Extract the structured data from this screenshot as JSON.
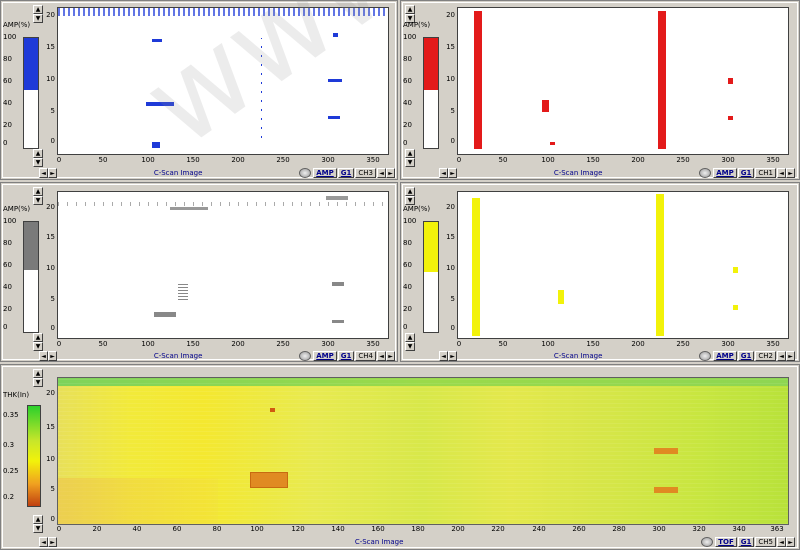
{
  "panels": {
    "ch3": {
      "ylabel": "AMP(%)",
      "scale": [
        "100",
        "80",
        "60",
        "40",
        "20",
        "0"
      ],
      "yticks": [
        "20",
        "15",
        "10",
        "5",
        "0"
      ],
      "xticks": [
        "0",
        "50",
        "100",
        "150",
        "200",
        "250",
        "300",
        "350"
      ],
      "caption": "C-Scan Image",
      "mode": "AMP",
      "gate": "G1",
      "channel": "CH3",
      "color": "#1e3ad8"
    },
    "ch1": {
      "ylabel": "AMP(%)",
      "scale": [
        "100",
        "80",
        "60",
        "40",
        "20",
        "0"
      ],
      "yticks": [
        "20",
        "15",
        "10",
        "5",
        "0"
      ],
      "xticks": [
        "0",
        "50",
        "100",
        "150",
        "200",
        "250",
        "300",
        "350"
      ],
      "caption": "C-Scan Image",
      "mode": "AMP",
      "gate": "G1",
      "channel": "CH1",
      "color": "#e31a1a"
    },
    "ch4": {
      "ylabel": "AMP(%)",
      "scale": [
        "100",
        "80",
        "60",
        "40",
        "20",
        "0"
      ],
      "yticks": [
        "20",
        "15",
        "10",
        "5",
        "0"
      ],
      "xticks": [
        "0",
        "50",
        "100",
        "150",
        "200",
        "250",
        "300",
        "350"
      ],
      "caption": "C-Scan Image",
      "mode": "AMP",
      "gate": "G1",
      "channel": "CH4",
      "color": "#7a7a7a"
    },
    "ch2": {
      "ylabel": "AMP(%)",
      "scale": [
        "100",
        "80",
        "60",
        "40",
        "20",
        "0"
      ],
      "yticks": [
        "20",
        "15",
        "10",
        "5",
        "0"
      ],
      "xticks": [
        "0",
        "50",
        "100",
        "150",
        "200",
        "250",
        "300",
        "350"
      ],
      "caption": "C-Scan Image",
      "mode": "AMP",
      "gate": "G1",
      "channel": "CH2",
      "color": "#f2f20a"
    },
    "ch5": {
      "ylabel": "THK(In)",
      "scale": [
        "0.35",
        "0.3",
        "0.25",
        "0.2"
      ],
      "yticks": [
        "20",
        "15",
        "10",
        "5",
        "0"
      ],
      "xticks": [
        "0",
        "20",
        "40",
        "60",
        "80",
        "100",
        "120",
        "140",
        "160",
        "180",
        "200",
        "220",
        "240",
        "260",
        "280",
        "300",
        "320",
        "340",
        "363"
      ],
      "caption": "C-Scan Image",
      "mode": "TOF",
      "gate": "G1",
      "channel": "CH5"
    }
  },
  "watermark": "www.ndt-auto.com",
  "icons": {
    "up": "▲",
    "down": "▼",
    "left": "◄",
    "right": "►"
  }
}
